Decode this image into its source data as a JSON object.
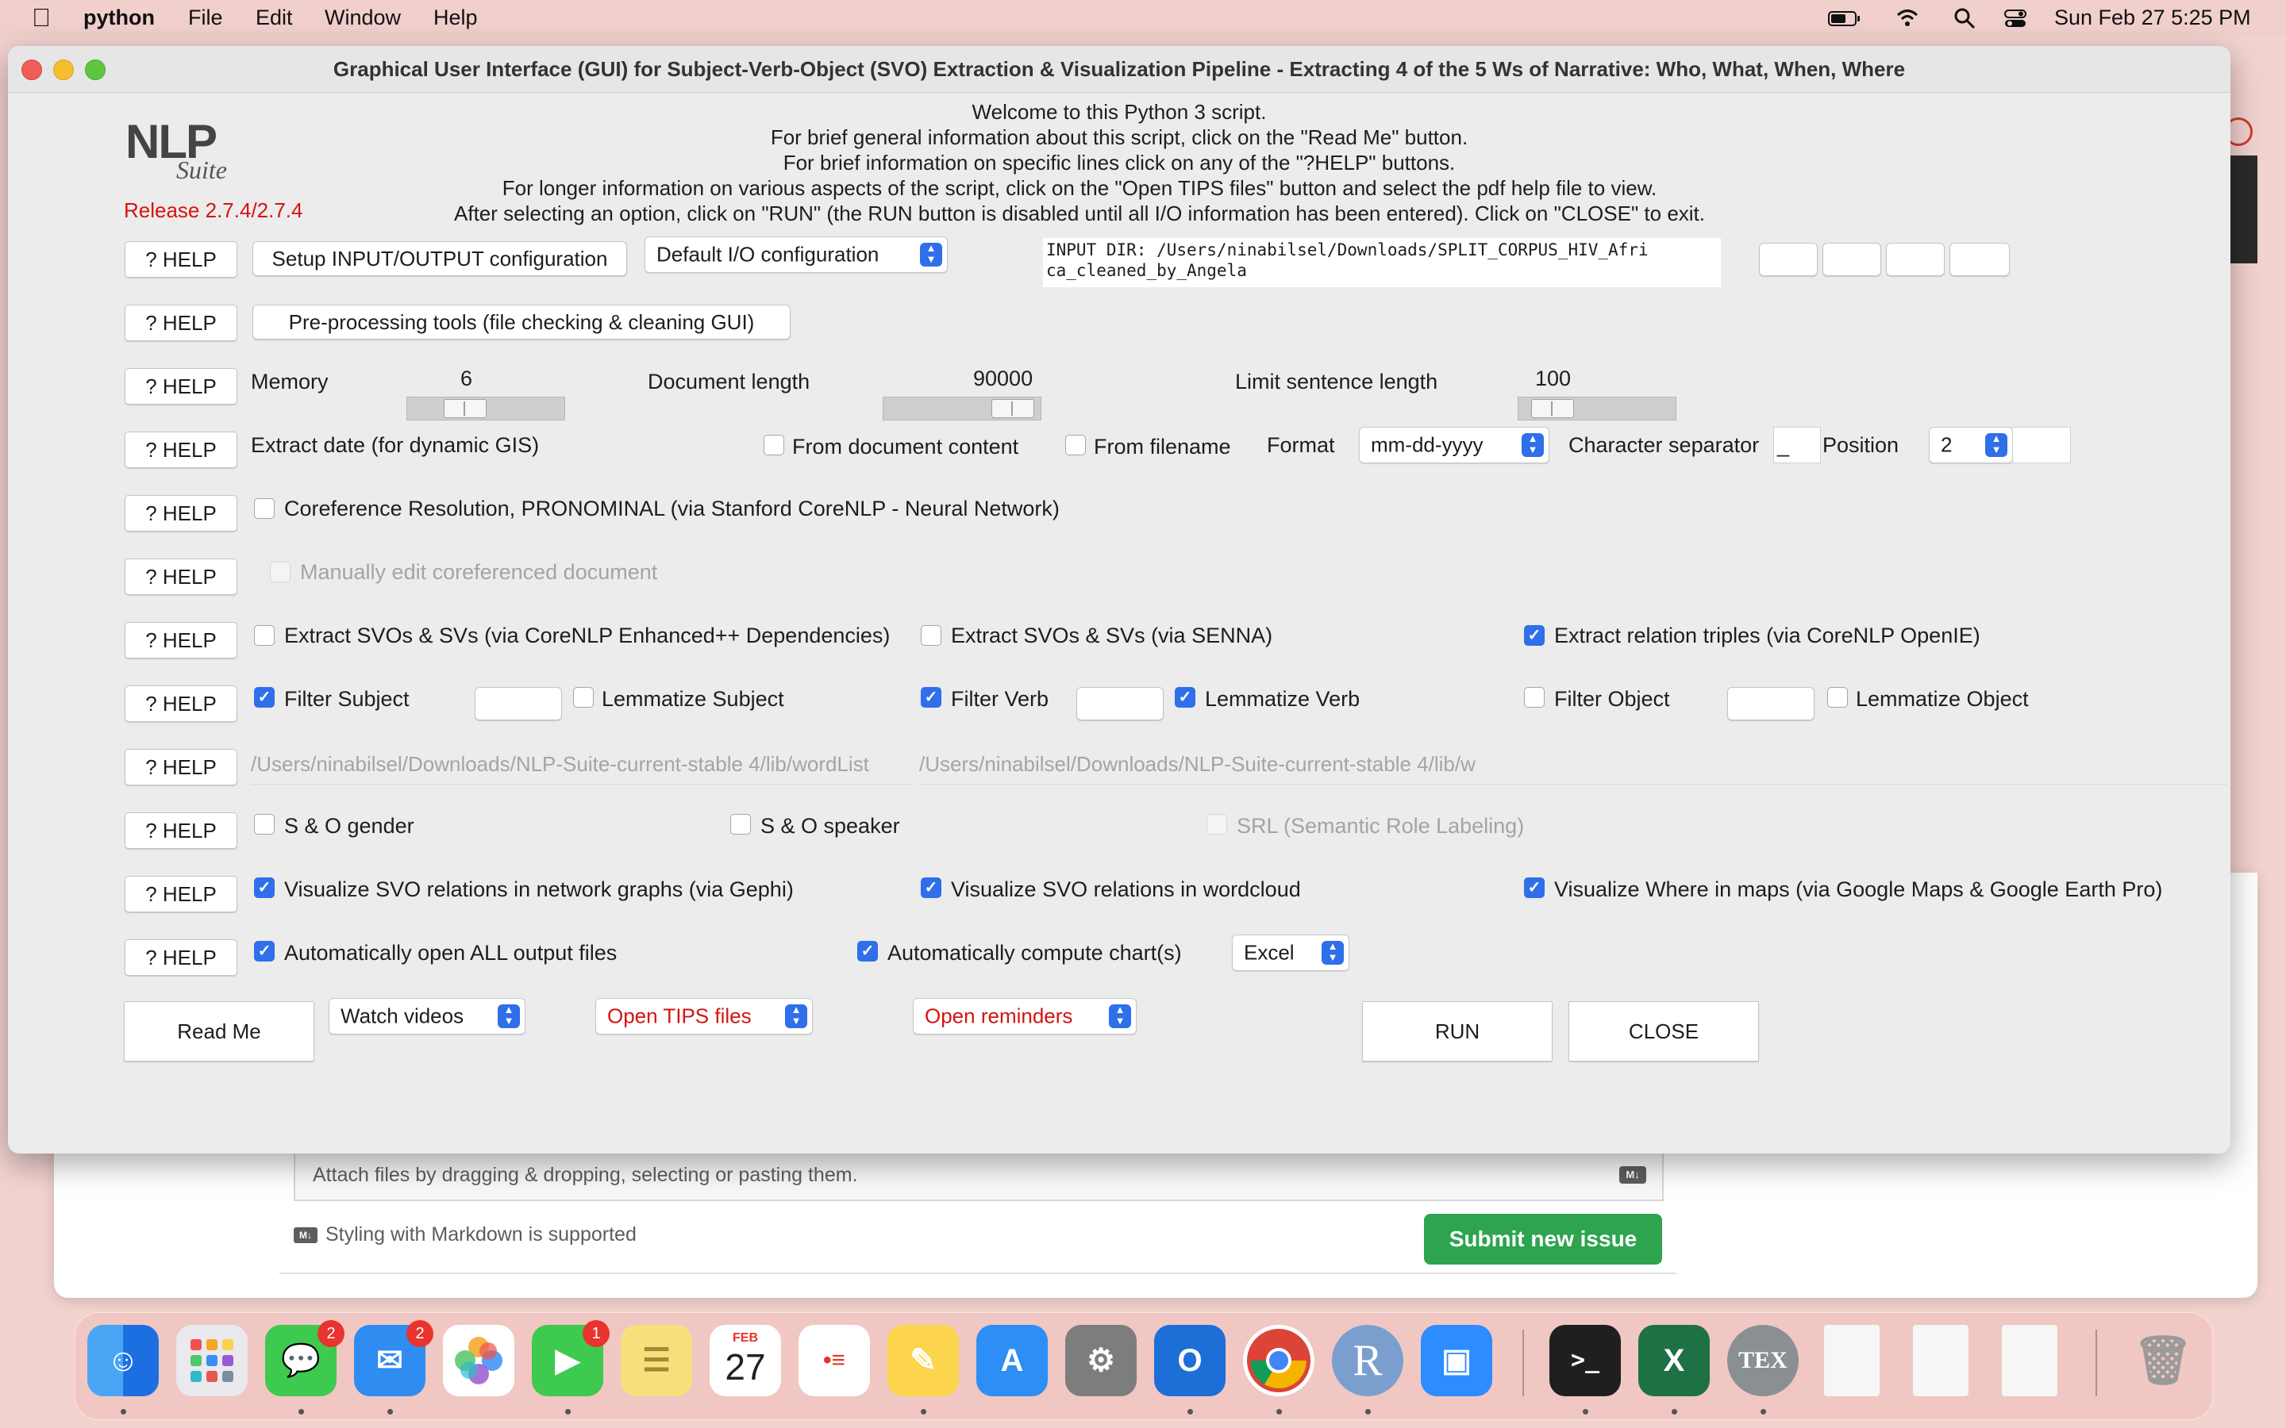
{
  "menubar": {
    "app_name": "python",
    "items": [
      "File",
      "Edit",
      "Window",
      "Help"
    ],
    "datetime": "Sun Feb 27  5:25 PM"
  },
  "window": {
    "title": "Graphical User Interface (GUI) for Subject-Verb-Object (SVO) Extraction & Visualization Pipeline - Extracting 4 of the 5 Ws of Narrative: Who, What, When, Where"
  },
  "logo": {
    "nlp": "NLP",
    "suite": "Suite",
    "release": "Release 2.7.4/2.7.4"
  },
  "welcome": [
    "Welcome to this Python 3 script.",
    "For brief general information about this script, click on the \"Read Me\" button.",
    "For brief information on specific lines click on any of the \"?HELP\" buttons.",
    "For longer information on various aspects of the script, click on the \"Open TIPS files\" button and select the pdf help file to view.",
    "After selecting an option, click on \"RUN\" (the RUN button is disabled until all I/O information has been entered).   Click on \"CLOSE\" to exit."
  ],
  "help_label": "? HELP",
  "io": {
    "setup_button": "Setup INPUT/OUTPUT configuration",
    "config_select": "Default I/O configuration",
    "input_dir_line1": "INPUT DIR: /Users/ninabilsel/Downloads/SPLIT_CORPUS_HIV_Afri",
    "input_dir_line2": "ca_cleaned_by_Angela"
  },
  "preprocessing_button": "Pre-processing tools (file checking & cleaning GUI)",
  "sliders": {
    "memory_label": "Memory",
    "memory_value": "6",
    "memory_fraction": 0.25,
    "doclength_label": "Document length",
    "doclength_value": "90000",
    "doclength_fraction": 0.8,
    "sentence_label": "Limit sentence length",
    "sentence_value": "100",
    "sentence_fraction": 0.1
  },
  "date": {
    "label": "Extract date (for dynamic GIS)",
    "from_content": "From document content",
    "from_filename": "From filename",
    "format_label": "Format",
    "format_value": "mm-dd-yyyy",
    "separator_label": "Character separator",
    "separator_value": "_",
    "position_label": "Position",
    "position_value": "2"
  },
  "coref": {
    "label": "Coreference Resolution, PRONOMINAL (via Stanford CoreNLP - Neural Network)",
    "manual_edit": "Manually edit coreferenced document"
  },
  "extract": {
    "corenlp_enhanced": "Extract SVOs & SVs (via CoreNLP Enhanced++ Dependencies)",
    "senna": "Extract SVOs & SVs (via SENNA)",
    "openie": "Extract relation triples (via CoreNLP OpenIE)"
  },
  "filters": {
    "filter_subject": "Filter Subject",
    "lemmatize_subject": "Lemmatize Subject",
    "filter_verb": "Filter Verb",
    "lemmatize_verb": "Lemmatize Verb",
    "filter_object": "Filter Object",
    "lemmatize_object": "Lemmatize Object"
  },
  "wordlists": {
    "path1": "/Users/ninabilsel/Downloads/NLP-Suite-current-stable 4/lib/wordList",
    "path2": "/Users/ninabilsel/Downloads/NLP-Suite-current-stable 4/lib/w"
  },
  "extras": {
    "gender": "S & O gender",
    "speaker": "S & O speaker",
    "srl": "SRL (Semantic Role Labeling)"
  },
  "visualize": {
    "gephi": "Visualize SVO relations in network graphs (via Gephi)",
    "wordcloud": "Visualize SVO relations in wordcloud",
    "maps": "Visualize Where in maps (via Google Maps & Google Earth Pro)"
  },
  "output": {
    "open_all": "Automatically open ALL output files",
    "compute_charts": "Automatically compute chart(s)",
    "chart_engine": "Excel"
  },
  "bottom": {
    "readme": "Read Me",
    "videos": "Watch videos",
    "tips": "Open TIPS files",
    "reminders": "Open reminders",
    "run": "RUN",
    "close": "CLOSE"
  },
  "background_page": {
    "attach_text": "Attach files by dragging & dropping, selecting or pasting them.",
    "markdown_note": "Styling with Markdown is supported",
    "submit_button": "Submit new issue",
    "md_badge": "M↓"
  },
  "dock": {
    "badges": {
      "messages": "2",
      "mail": "2",
      "facetime": "1"
    },
    "calendar_month": "FEB",
    "calendar_day": "27",
    "r_label": "R",
    "tex_label": "TEX",
    "excel_label": "X",
    "outlook_label": "O",
    "terminal_label": ">_"
  },
  "colors": {
    "accent_blue": "#2f6fea",
    "release_red": "#d4140f",
    "submit_green": "#2ea44f"
  }
}
